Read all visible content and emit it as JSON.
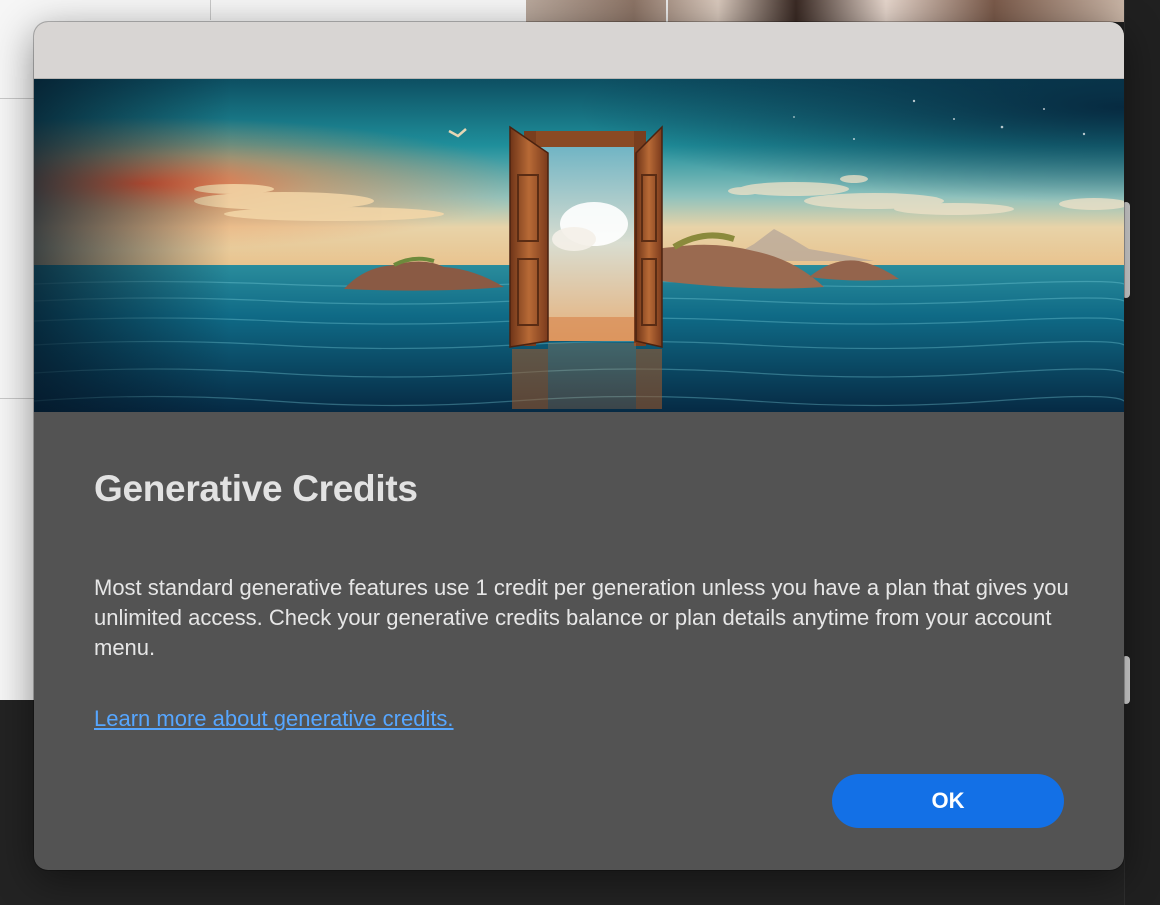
{
  "dialog": {
    "title": "Generative Credits",
    "body": "Most standard generative features use 1 credit per generation unless you have a plan that gives you unlimited access. Check your generative credits balance or plan details anytime from your account menu.",
    "link_label": "Learn more about generative credits.",
    "ok_label": "OK"
  },
  "hero": {
    "subject": "door-in-ocean-illustration"
  },
  "colors": {
    "dialog_background": "#535353",
    "titlebar": "#d8d5d3",
    "link": "#56a6ff",
    "primary_button": "#1370e6"
  }
}
